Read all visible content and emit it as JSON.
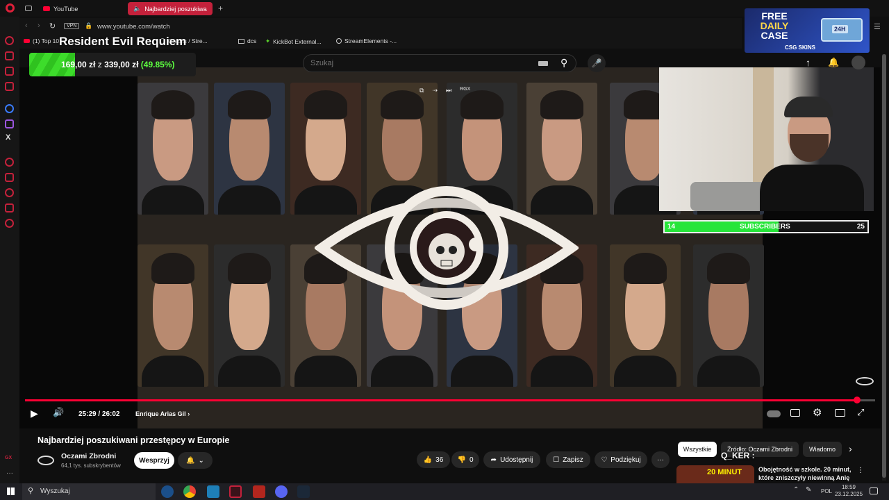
{
  "browser": {
    "tabs": [
      {
        "label": "YouTube",
        "active": false
      },
      {
        "label": "Najbardziej poszukiwani",
        "active": true
      }
    ],
    "new_tab": "+",
    "vpn_badge": "VPN",
    "url": "www.youtube.com/watch",
    "bookmarks": [
      "(1) Top 10",
      "Credits / Stre...",
      "dcs",
      "KickBot External...",
      "StreamElements -..."
    ]
  },
  "overlay": {
    "game_title": "Resident Evil Requiem",
    "price_current": "169,00 zł",
    "price_separator": "z",
    "price_total": "339,00 zł",
    "price_percent": "(49.85%)",
    "progress_fraction": 0.4985,
    "ad_line1": "FREE",
    "ad_line2": "DAILY",
    "ad_line3": "CASE",
    "ad_brand": "CSG SKINS",
    "ad_badge": "24H",
    "subs_current": "14",
    "subs_label": "SUBSCRIBERS",
    "subs_goal": "25",
    "subs_fraction": 0.56,
    "chat_user": "Q_KER :"
  },
  "youtube": {
    "search_placeholder": "Szukaj",
    "video_time": "25:29 / 26:02",
    "chapter": "Enrique Arias Gil",
    "progress_fraction": 0.979,
    "video_title": "Najbardziej poszukiwani przestępcy w Europie",
    "channel_name": "Oczami Zbrodni",
    "channel_subs": "64,1 tys. subskrybentów",
    "support_button": "Wesprzyj",
    "likes": "36",
    "dislikes": "0",
    "share": "Udostępnij",
    "save": "Zapisz",
    "thanks": "Podziękuj",
    "chips": [
      "Wszystkie",
      "Źródło: Oczami Zbrodni",
      "Wiadomo"
    ],
    "rec_title": "Obojętność w szkole. 20 minut, które zniszczyły niewinną Anię",
    "rec_thumb_text": "20 MINUT"
  },
  "taskbar": {
    "search": "Wyszukaj",
    "lang": "POL",
    "time": "18:59",
    "date": "23.12.2025"
  },
  "colors": {
    "accent": "#ff0033",
    "progress_green": "#3ddc2b",
    "subs_green": "#27e53a",
    "opera_red": "#c4213b"
  }
}
